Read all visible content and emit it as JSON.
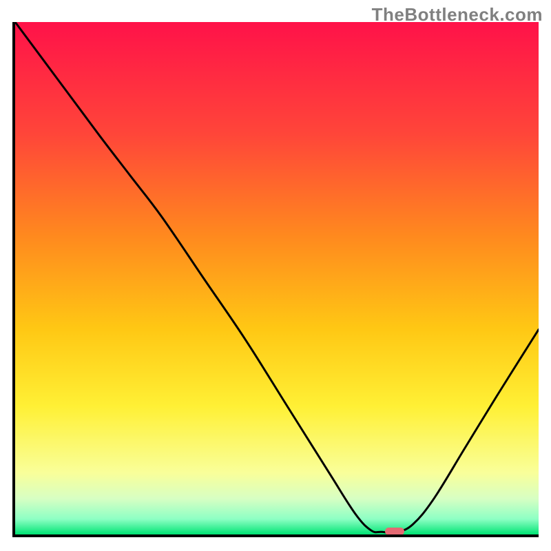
{
  "watermark": "TheBottleneck.com",
  "chart_data": {
    "type": "line",
    "title": "",
    "xlabel": "",
    "ylabel": "",
    "x_range_pct": [
      0,
      100
    ],
    "y_range_pct": [
      0,
      100
    ],
    "series": [
      {
        "name": "bottleneck-curve",
        "points_pct": [
          {
            "x": 0.0,
            "y": 100.0
          },
          {
            "x": 8.0,
            "y": 89.0
          },
          {
            "x": 16.0,
            "y": 78.0
          },
          {
            "x": 22.0,
            "y": 70.0
          },
          {
            "x": 28.0,
            "y": 62.0
          },
          {
            "x": 36.0,
            "y": 50.0
          },
          {
            "x": 44.0,
            "y": 38.0
          },
          {
            "x": 52.0,
            "y": 25.0
          },
          {
            "x": 60.0,
            "y": 12.0
          },
          {
            "x": 65.0,
            "y": 4.0
          },
          {
            "x": 68.0,
            "y": 0.8
          },
          {
            "x": 70.0,
            "y": 0.5
          },
          {
            "x": 73.0,
            "y": 0.5
          },
          {
            "x": 76.0,
            "y": 2.0
          },
          {
            "x": 80.0,
            "y": 7.0
          },
          {
            "x": 86.0,
            "y": 17.0
          },
          {
            "x": 92.0,
            "y": 27.0
          },
          {
            "x": 100.0,
            "y": 40.0
          }
        ]
      }
    ],
    "marker": {
      "x_pct": 72.5,
      "y_pct": 0.6,
      "width_pct": 3.6,
      "height_pct": 1.4,
      "color": "#e46a73"
    },
    "background_gradient": {
      "top": "#ff1249",
      "c20": "#ff4639",
      "c40": "#ff8a1e",
      "c60": "#ffc814",
      "c75": "#fff035",
      "c88": "#f9ff9a",
      "c93": "#d7ffc3",
      "c97": "#8dffc4",
      "bottom": "#00e474"
    },
    "gridlines": false,
    "legend": false
  }
}
